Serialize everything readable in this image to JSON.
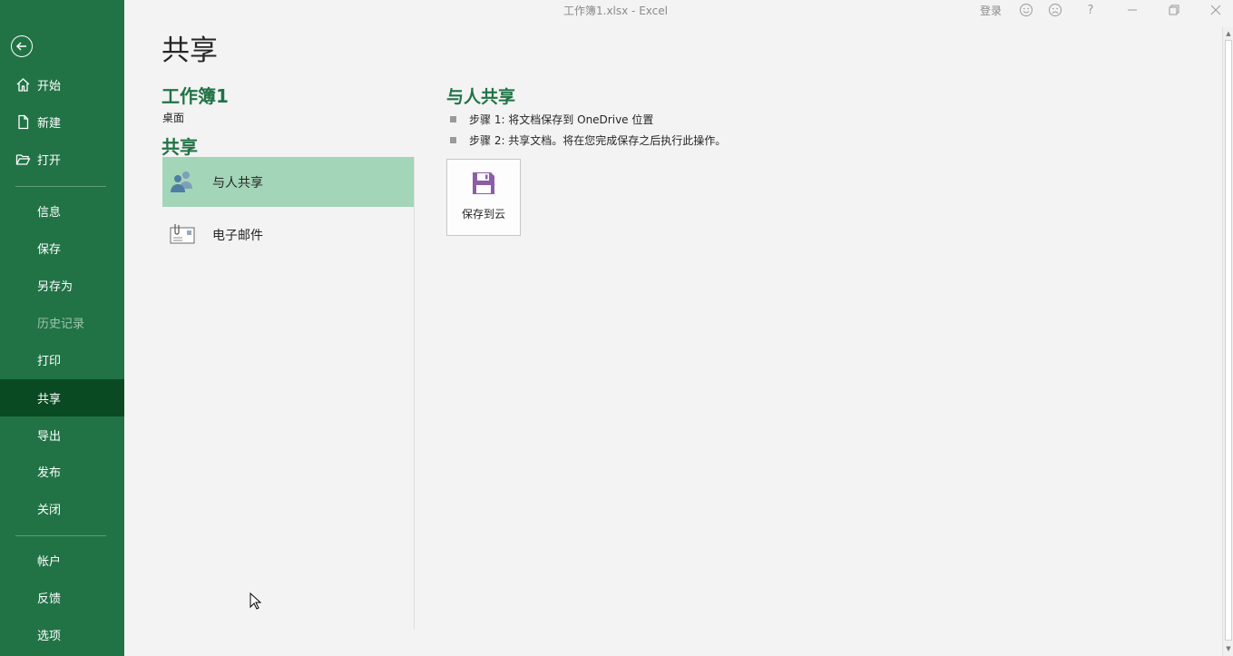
{
  "window": {
    "title": "工作簿1.xlsx  -  Excel",
    "login_label": "登录",
    "icons": [
      "smile-icon",
      "frown-icon",
      "help-icon",
      "minimize-icon",
      "restore-icon",
      "close-icon"
    ],
    "help_glyph": "?"
  },
  "sidebar": {
    "back_icon": "back-arrow-icon",
    "items_top": [
      {
        "label": "开始",
        "icon": "home-icon"
      },
      {
        "label": "新建",
        "icon": "new-doc-icon"
      },
      {
        "label": "打开",
        "icon": "open-folder-icon"
      }
    ],
    "items_mid": [
      {
        "label": "信息"
      },
      {
        "label": "保存"
      },
      {
        "label": "另存为"
      },
      {
        "label": "历史记录",
        "disabled": true
      },
      {
        "label": "打印"
      },
      {
        "label": "共享",
        "active": true
      },
      {
        "label": "导出"
      },
      {
        "label": "发布"
      },
      {
        "label": "关闭"
      }
    ],
    "items_bottom": [
      {
        "label": "帐户"
      },
      {
        "label": "反馈"
      },
      {
        "label": "选项"
      }
    ],
    "colors": {
      "background": "#217346",
      "active": "#0a4a22"
    }
  },
  "main": {
    "page_title": "共享",
    "document_name": "工作簿1",
    "document_location": "桌面",
    "share_heading": "共享",
    "share_options": [
      {
        "label": "与人共享",
        "icon": "people-icon",
        "selected": true
      },
      {
        "label": "电子邮件",
        "icon": "email-icon",
        "selected": false
      }
    ],
    "detail": {
      "heading": "与人共享",
      "steps": [
        "步骤 1: 将文档保存到 OneDrive 位置",
        "步骤 2: 共享文档。将在您完成保存之后执行此操作。"
      ],
      "save_button_label": "保存到云",
      "save_button_icon": "save-disk-icon"
    }
  },
  "accent_colors": {
    "green": "#217346",
    "selected_option": "#a3d5b8",
    "save_icon": "#8b5ea7"
  }
}
